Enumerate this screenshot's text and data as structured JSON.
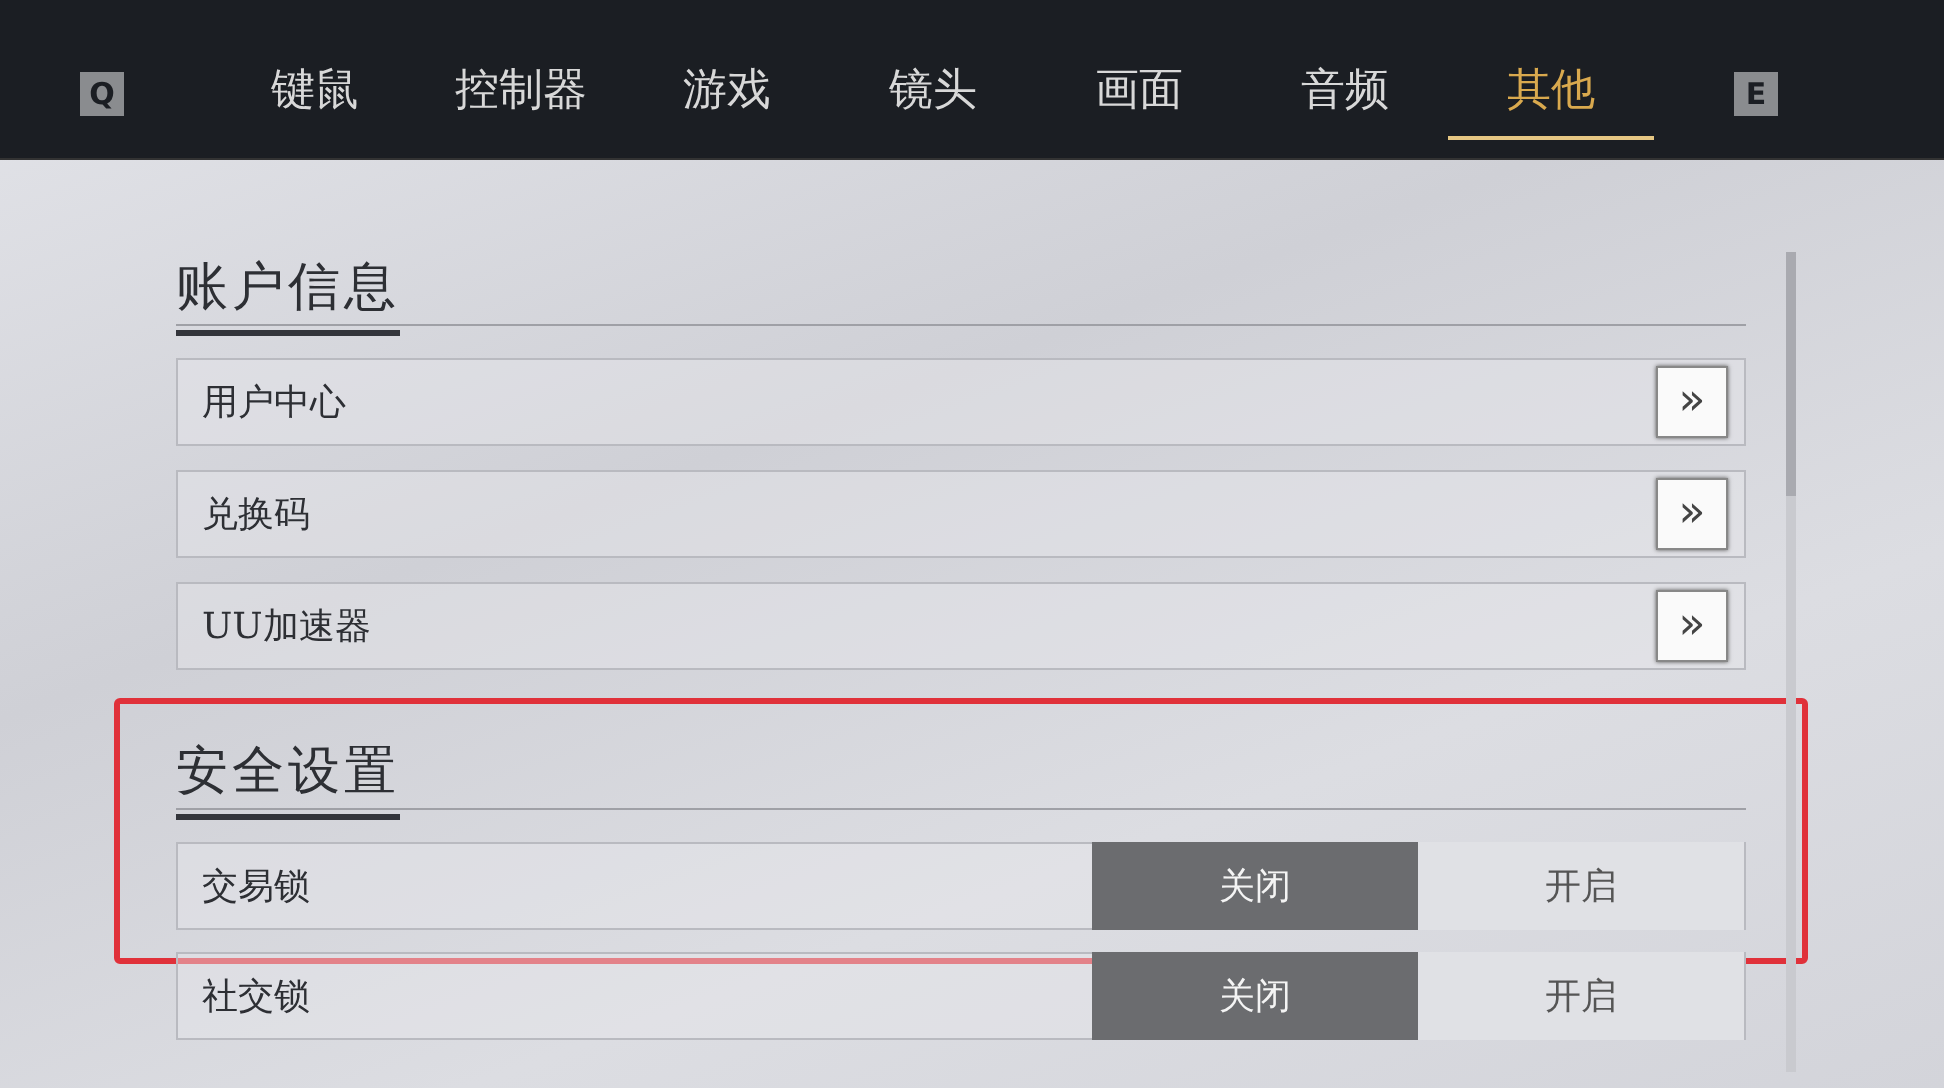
{
  "top_bar": {
    "prev_key": "Q",
    "next_key": "E",
    "tabs": [
      {
        "label": "键鼠",
        "selected": false
      },
      {
        "label": "控制器",
        "selected": false
      },
      {
        "label": "游戏",
        "selected": false
      },
      {
        "label": "镜头",
        "selected": false
      },
      {
        "label": "画面",
        "selected": false
      },
      {
        "label": "音频",
        "selected": false
      },
      {
        "label": "其他",
        "selected": true
      }
    ]
  },
  "sections": [
    {
      "title": "账户信息",
      "rows": [
        {
          "kind": "link",
          "label": "用户中心",
          "button": "»"
        },
        {
          "kind": "link",
          "label": "兑换码",
          "button": "»"
        },
        {
          "kind": "link",
          "label": "UU加速器",
          "button": "»"
        }
      ]
    },
    {
      "title": "安全设置",
      "highlighted": true,
      "rows": [
        {
          "kind": "toggle",
          "label": "交易锁",
          "highlighted": true,
          "options": [
            {
              "label": "关闭",
              "selected": true
            },
            {
              "label": "开启",
              "selected": false
            }
          ]
        },
        {
          "kind": "toggle",
          "label": "社交锁",
          "highlighted": false,
          "options": [
            {
              "label": "关闭",
              "selected": true
            },
            {
              "label": "开启",
              "selected": false
            }
          ]
        }
      ]
    }
  ]
}
